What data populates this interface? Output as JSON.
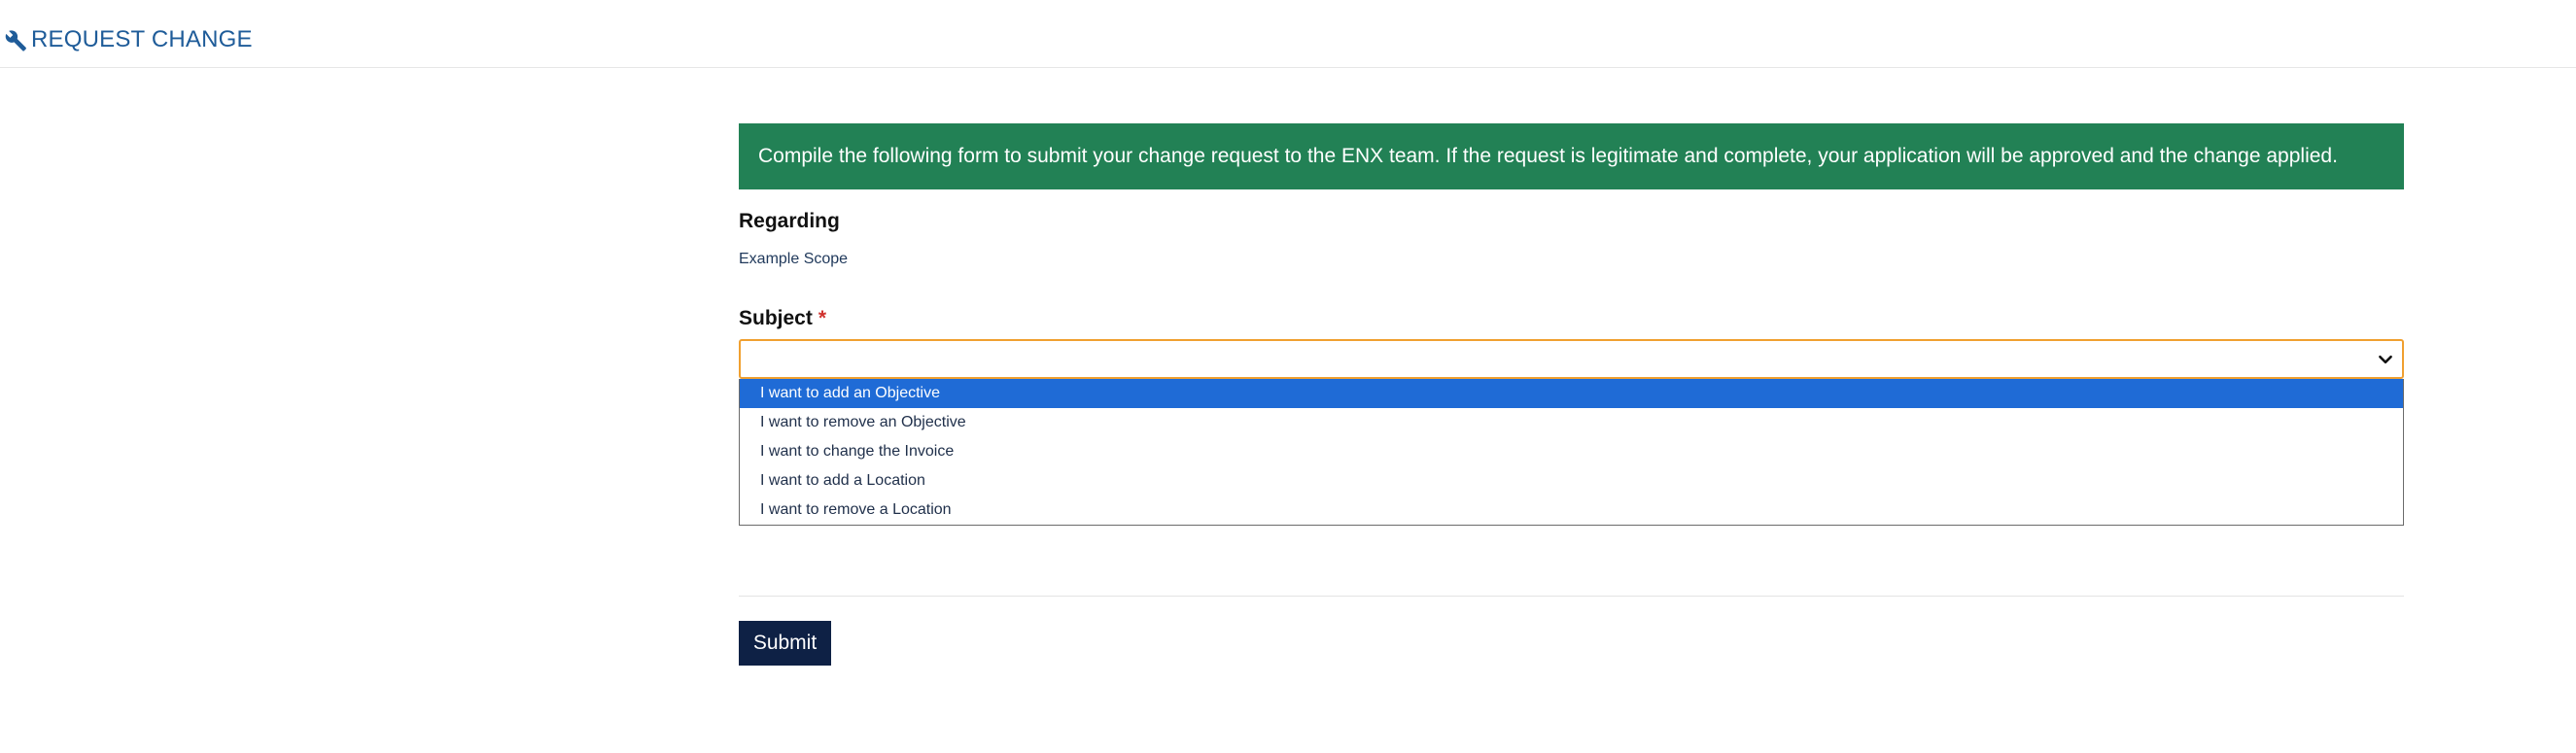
{
  "header": {
    "icon": "wrench-icon",
    "title": "REQUEST CHANGE"
  },
  "form": {
    "info_message": "Compile the following form to submit your change request to the ENX team. If the request is legitimate and complete, your application will be approved and the change applied.",
    "regarding_label": "Regarding",
    "regarding_value": "Example Scope",
    "subject_label": "Subject",
    "required_marker": "*",
    "subject_value": "",
    "subject_options": [
      "I want to add an Objective",
      "I want to remove an Objective",
      "I want to change the Invoice",
      "I want to add a Location",
      "I want to remove a Location"
    ],
    "highlighted_option_index": 0,
    "submit_label": "Submit"
  },
  "colors": {
    "accent": "#1f5c99",
    "alert_bg": "#228155",
    "focus_border": "#f0a030",
    "option_highlight": "#1f6bd6",
    "submit_bg": "#0e2145",
    "required": "#d0312d"
  }
}
